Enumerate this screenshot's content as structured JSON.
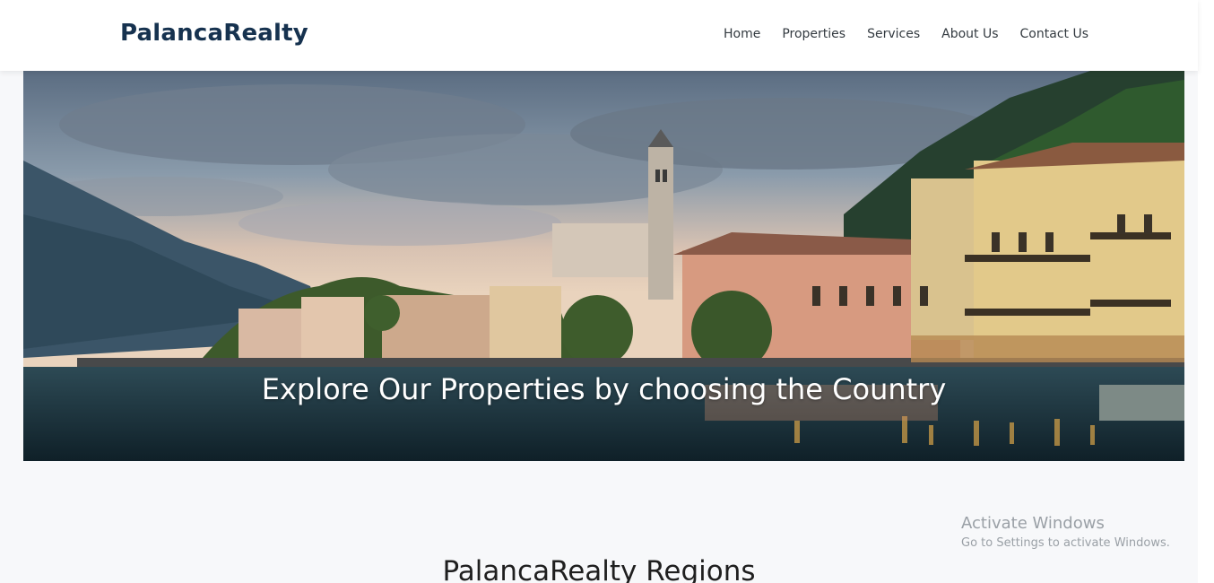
{
  "brand": {
    "name": "PalancaRealty"
  },
  "nav": {
    "items": [
      {
        "label": "Home"
      },
      {
        "label": "Properties"
      },
      {
        "label": "Services"
      },
      {
        "label": "About Us"
      },
      {
        "label": "Contact Us"
      }
    ]
  },
  "hero": {
    "caption": "Explore Our Properties by choosing the Country"
  },
  "section": {
    "title": "PalancaRealty Regions"
  },
  "watermark": {
    "title": "Activate Windows",
    "subtitle": "Go to Settings to activate Windows."
  },
  "colors": {
    "brand": "#16324f",
    "background": "#f7f8fa"
  }
}
